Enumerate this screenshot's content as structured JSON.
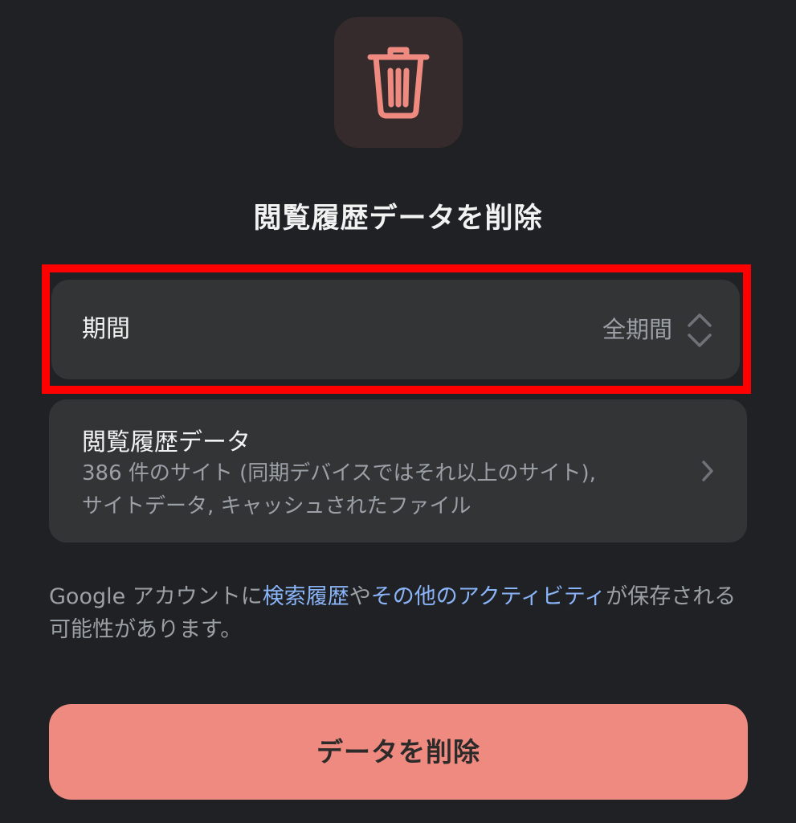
{
  "dialog": {
    "title": "閲覧履歴データを削除",
    "icon": "trash-icon",
    "accent_color": "#ee8a80"
  },
  "period": {
    "label": "期間",
    "value": "全期間",
    "icon": "updown-chevron-icon"
  },
  "browsing_data": {
    "title": "閲覧履歴データ",
    "line1": "386 件のサイト (同期デバイスではそれ以上のサイト),",
    "line2": "サイトデータ, キャッシュされたファイル",
    "icon": "chevron-right-icon"
  },
  "info": {
    "prefix": "Google アカウントに",
    "link1": "検索履歴",
    "middle": "や",
    "link2": "その他のアクティビティ",
    "suffix": "が保存される可能性があります。",
    "link_color": "#8ab4f8"
  },
  "delete_button": {
    "label": "データを削除"
  }
}
